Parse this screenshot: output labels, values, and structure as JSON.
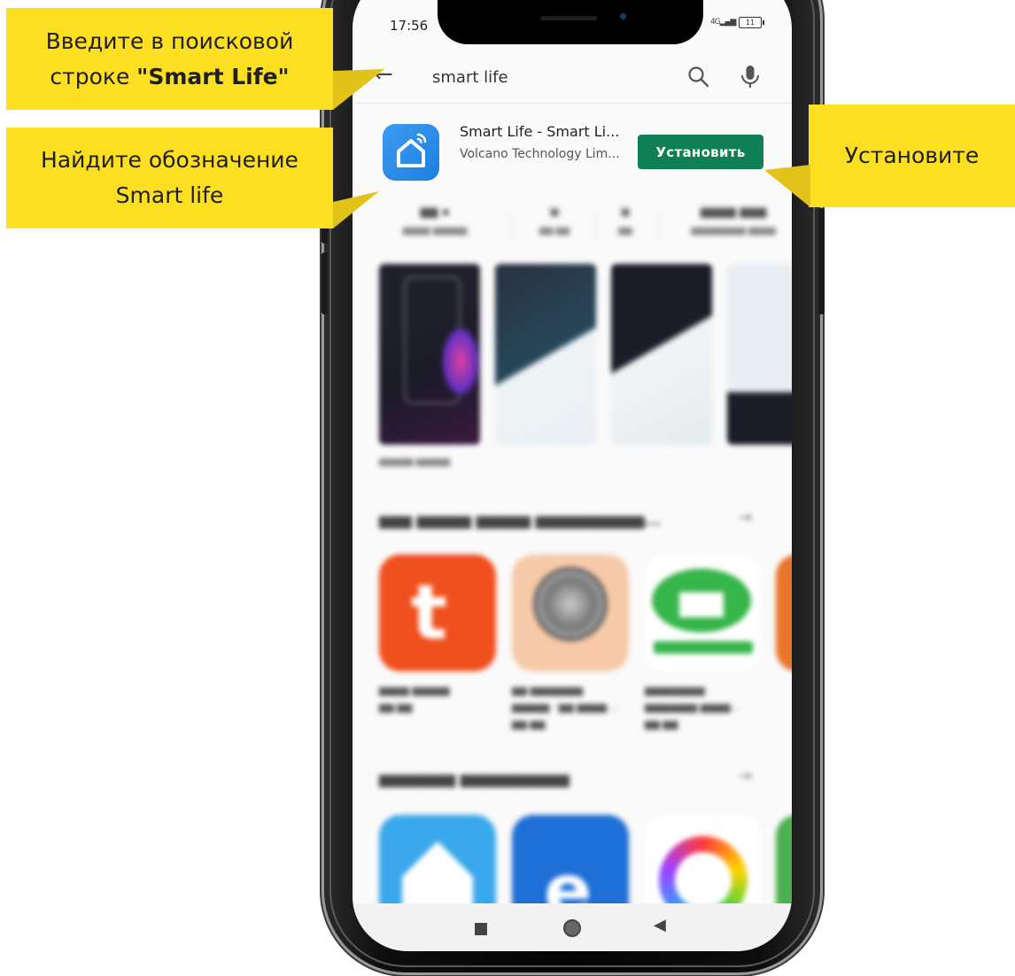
{
  "callouts": {
    "search_line1": "Введите в поисковой",
    "search_line2_prefix": "строке ",
    "search_line2_bold": "\"Smart Life\"",
    "find_line1": "Найдите обозначение",
    "find_line2": "Smart life",
    "install": "Установите"
  },
  "status_bar": {
    "time": "17:56",
    "signal": "4G",
    "battery": "11"
  },
  "search": {
    "query": "smart life"
  },
  "app": {
    "name": "Smart Life - Smart Li...",
    "developer": "Volcano Technology Lim...",
    "install_label": "Установить"
  },
  "icons": {
    "back": "arrow-left-icon",
    "search": "search-icon",
    "mic": "mic-icon",
    "app": "smart-home-icon",
    "nav": [
      "square-icon",
      "circle-icon",
      "triangle-back-icon"
    ]
  },
  "colors": {
    "callout": "#fcdf20",
    "install": "#0f7f56",
    "app_icon": "#2a8ce8"
  }
}
